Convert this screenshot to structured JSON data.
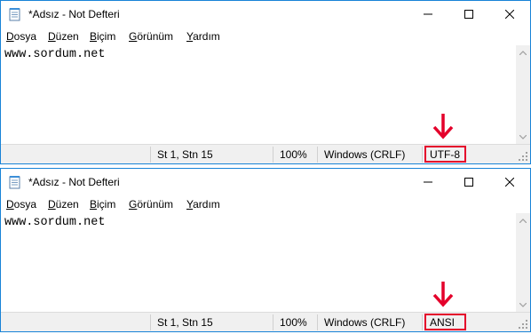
{
  "windows": [
    {
      "title": "*Adsız - Not Defteri",
      "menu": [
        {
          "accel": "D",
          "rest": "osya"
        },
        {
          "accel": "D",
          "rest": "üzen"
        },
        {
          "accel": "B",
          "rest": "içim"
        },
        {
          "accel": "G",
          "rest": "örünüm"
        },
        {
          "accel": "Y",
          "rest": "ardım"
        }
      ],
      "content": "www.sordum.net",
      "status": {
        "position": "St 1, Stn 15",
        "zoom": "100%",
        "line_ending": "Windows (CRLF)",
        "encoding": "UTF-8"
      }
    },
    {
      "title": "*Adsız - Not Defteri",
      "menu": [
        {
          "accel": "D",
          "rest": "osya"
        },
        {
          "accel": "D",
          "rest": "üzen"
        },
        {
          "accel": "B",
          "rest": "içim"
        },
        {
          "accel": "G",
          "rest": "örünüm"
        },
        {
          "accel": "Y",
          "rest": "ardım"
        }
      ],
      "content": "www.sordum.net",
      "status": {
        "position": "St 1, Stn 15",
        "zoom": "100%",
        "line_ending": "Windows (CRLF)",
        "encoding": "ANSI"
      }
    }
  ],
  "colors": {
    "highlight": "#e4002b",
    "border": "#1883d7",
    "statusbar": "#f0f0f0"
  },
  "icons": [
    "notepad-icon",
    "minimize-icon",
    "maximize-icon",
    "close-icon",
    "scroll-up-icon",
    "scroll-down-icon",
    "resize-grip-icon",
    "red-down-arrow-icon"
  ]
}
